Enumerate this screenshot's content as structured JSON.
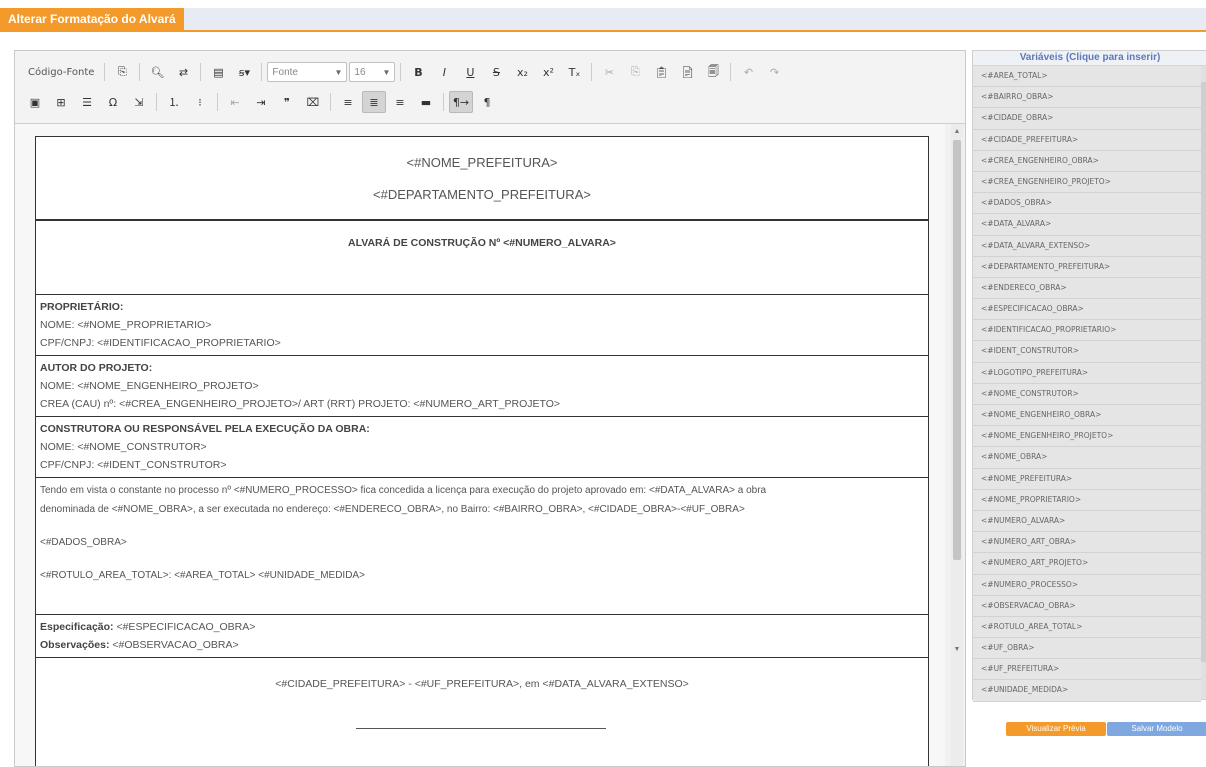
{
  "window": {
    "title": "Alterar Formatação do Alvará"
  },
  "toolbar": {
    "row1": [
      {
        "name": "source-code-button",
        "icon": "document-icon",
        "label": "Código-Fonte"
      },
      {
        "sep": true
      },
      {
        "name": "templates-button",
        "icon": "template-icon",
        "label": "⎘"
      },
      {
        "sep": true
      },
      {
        "name": "find-button",
        "icon": "search-icon",
        "label": "🔍︎"
      },
      {
        "name": "replace-button",
        "icon": "replace-icon",
        "label": "⇄"
      },
      {
        "sep": true
      },
      {
        "name": "spellcheck-button",
        "icon": "spellcheck-icon",
        "label": "▤"
      },
      {
        "name": "spellcheck-menu-button",
        "icon": "abc-check-icon",
        "label": "ꞩ▾"
      },
      {
        "sep": true
      },
      {
        "combo": "font",
        "label": "Fonte"
      },
      {
        "combo": "size",
        "label": "16"
      },
      {
        "sep": true
      },
      {
        "name": "bold-button",
        "icon": "bold-icon",
        "label": "B"
      },
      {
        "name": "italic-button",
        "icon": "italic-icon",
        "label": "I"
      },
      {
        "name": "underline-button",
        "icon": "underline-icon",
        "label": "U"
      },
      {
        "name": "strike-button",
        "icon": "strikethrough-icon",
        "label": "S"
      },
      {
        "name": "subscript-button",
        "icon": "subscript-icon",
        "label": "x₂"
      },
      {
        "name": "superscript-button",
        "icon": "superscript-icon",
        "label": "x²"
      },
      {
        "name": "remove-format-button",
        "icon": "remove-format-icon",
        "label": "Tₓ"
      },
      {
        "sep": true
      },
      {
        "name": "cut-button",
        "icon": "cut-icon",
        "label": "✂",
        "gray": true
      },
      {
        "name": "copy-button",
        "icon": "copy-icon",
        "label": "⎘",
        "gray": true
      },
      {
        "name": "paste-button",
        "icon": "paste-icon",
        "label": "📋︎"
      },
      {
        "name": "paste-text-button",
        "icon": "paste-text-icon",
        "label": "📄︎"
      },
      {
        "name": "paste-word-button",
        "icon": "paste-word-icon",
        "label": "🗐"
      },
      {
        "sep": true
      },
      {
        "name": "undo-button",
        "icon": "undo-icon",
        "label": "↶",
        "gray": true
      },
      {
        "name": "redo-button",
        "icon": "redo-icon",
        "label": "↷",
        "gray": true
      }
    ],
    "row2": [
      {
        "name": "image-button",
        "icon": "image-icon",
        "label": "▣"
      },
      {
        "name": "table-button",
        "icon": "table-icon",
        "label": "⊞"
      },
      {
        "name": "hr-button",
        "icon": "horizontal-rule-icon",
        "label": "☰"
      },
      {
        "name": "special-char-button",
        "icon": "omega-icon",
        "label": "Ω"
      },
      {
        "name": "page-break-button",
        "icon": "page-break-icon",
        "label": "⇲"
      },
      {
        "sep": true
      },
      {
        "name": "numbered-list-button",
        "icon": "numbered-list-icon",
        "label": "⒈"
      },
      {
        "name": "bullet-list-button",
        "icon": "bullet-list-icon",
        "label": "⁝"
      },
      {
        "sep": true
      },
      {
        "name": "outdent-button",
        "icon": "outdent-icon",
        "label": "⇤",
        "gray": true
      },
      {
        "name": "indent-button",
        "icon": "indent-icon",
        "label": "⇥"
      },
      {
        "name": "blockquote-button",
        "icon": "quote-icon",
        "label": "❞"
      },
      {
        "name": "div-button",
        "icon": "div-icon",
        "label": "⌧"
      },
      {
        "sep": true
      },
      {
        "name": "align-left-button",
        "icon": "align-left-icon",
        "label": "≡"
      },
      {
        "name": "align-center-button",
        "icon": "align-center-icon",
        "label": "≣",
        "active": true
      },
      {
        "name": "align-right-button",
        "icon": "align-right-icon",
        "label": "≡"
      },
      {
        "name": "justify-button",
        "icon": "justify-icon",
        "label": "▬"
      },
      {
        "sep": true
      },
      {
        "name": "ltr-button",
        "icon": "text-direction-icon",
        "label": "¶→",
        "active": true
      },
      {
        "name": "rtl-button",
        "icon": "paragraph-icon",
        "label": "¶"
      }
    ]
  },
  "document": {
    "header_line1": "<#NOME_PREFEITURA>",
    "header_line2": "<#DEPARTAMENTO_PREFEITURA>",
    "title": "ALVARÁ DE CONSTRUÇÃO Nº <#NUMERO_ALVARA>",
    "owner": {
      "label": "PROPRIETÁRIO:",
      "line1": "NOME: <#NOME_PROPRIETARIO>",
      "line2": "CPF/CNPJ: <#IDENTIFICACAO_PROPRIETARIO>"
    },
    "author": {
      "label": "AUTOR DO PROJETO:",
      "line1": "NOME: <#NOME_ENGENHEIRO_PROJETO>",
      "line2": "CREA (CAU) nº: <#CREA_ENGENHEIRO_PROJETO>/ ART (RRT) PROJETO: <#NUMERO_ART_PROJETO>"
    },
    "builder": {
      "label": "CONSTRUTORA OU RESPONSÁVEL PELA EXECUÇÃO DA OBRA:",
      "line1": "NOME: <#NOME_CONSTRUTOR>",
      "line2": "CPF/CNPJ: <#IDENT_CONSTRUTOR>"
    },
    "body": {
      "para1": "Tendo em vista o constante no processo nº <#NUMERO_PROCESSO> fica concedida a licença para execução do projeto aprovado em: <#DATA_ALVARA> a obra",
      "para2": "denominada de <#NOME_OBRA>, a ser executada no endereço: <#ENDERECO_OBRA>, no Bairro: <#BAIRRO_OBRA>, <#CIDADE_OBRA>-<#UF_OBRA>",
      "dados": "<#DADOS_OBRA>",
      "area": "<#ROTULO_AREA_TOTAL>: <#AREA_TOTAL> <#UNIDADE_MEDIDA>"
    },
    "spec": {
      "label": "Especificação:",
      "value": " <#ESPECIFICACAO_OBRA>",
      "obs_label": "Observações:",
      "obs_value": " <#OBSERVACAO_OBRA>"
    },
    "signature": "<#CIDADE_PREFEITURA> - <#UF_PREFEITURA>, em <#DATA_ALVARA_EXTENSO>"
  },
  "variables": {
    "title": "Variáveis (Clique para inserir)",
    "items": [
      "<#AREA_TOTAL>",
      "<#BAIRRO_OBRA>",
      "<#CIDADE_OBRA>",
      "<#CIDADE_PREFEITURA>",
      "<#CREA_ENGENHEIRO_OBRA>",
      "<#CREA_ENGENHEIRO_PROJETO>",
      "<#DADOS_OBRA>",
      "<#DATA_ALVARA>",
      "<#DATA_ALVARA_EXTENSO>",
      "<#DEPARTAMENTO_PREFEITURA>",
      "<#ENDERECO_OBRA>",
      "<#ESPECIFICACAO_OBRA>",
      "<#IDENTIFICACAO_PROPRIETARIO>",
      "<#IDENT_CONSTRUTOR>",
      "<#LOGOTIPO_PREFEITURA>",
      "<#NOME_CONSTRUTOR>",
      "<#NOME_ENGENHEIRO_OBRA>",
      "<#NOME_ENGENHEIRO_PROJETO>",
      "<#NOME_OBRA>",
      "<#NOME_PREFEITURA>",
      "<#NOME_PROPRIETARIO>",
      "<#NUMERO_ALVARA>",
      "<#NUMERO_ART_OBRA>",
      "<#NUMERO_ART_PROJETO>",
      "<#NUMERO_PROCESSO>",
      "<#OBSERVACAO_OBRA>",
      "<#ROTULO_AREA_TOTAL>",
      "<#UF_OBRA>",
      "<#UF_PREFEITURA>",
      "<#UNIDADE_MEDIDA>"
    ]
  },
  "buttons": {
    "preview": "Visualizar Prévia",
    "save": "Salvar Modelo"
  },
  "colors": {
    "accent": "#f39a2b",
    "link": "#5d7ab6",
    "save": "#7fa8e0"
  }
}
